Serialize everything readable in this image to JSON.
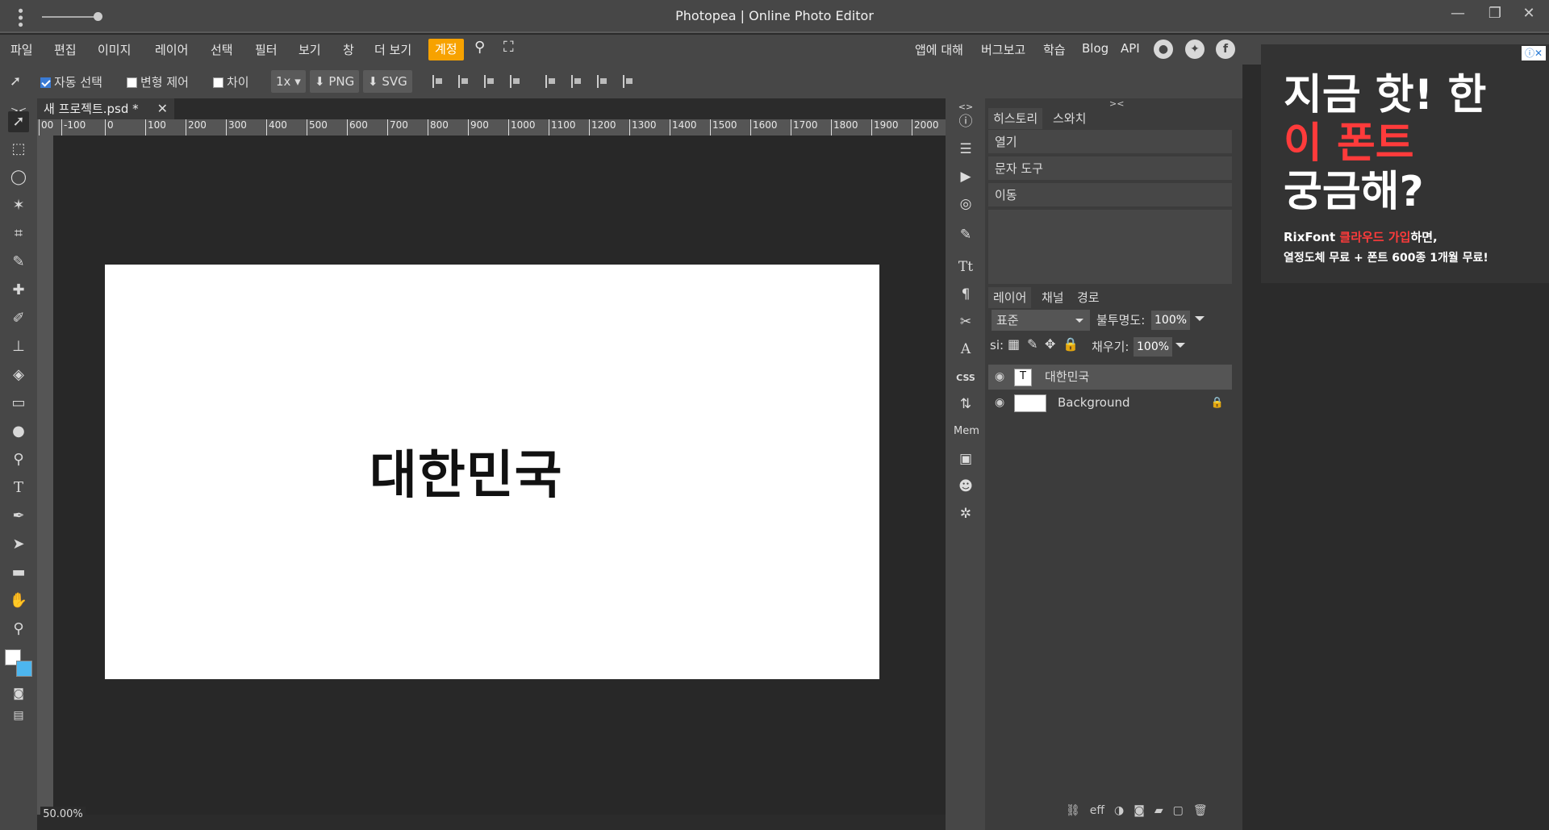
{
  "window": {
    "title": "Photopea | Online Photo Editor"
  },
  "menu": {
    "items": [
      "파일",
      "편집",
      "이미지",
      "레이어",
      "선택",
      "필터",
      "보기",
      "창",
      "더 보기"
    ],
    "account": "계정",
    "right_items": [
      "앱에 대해",
      "버그보고",
      "학습",
      "Blog",
      "API"
    ]
  },
  "options": {
    "auto_select": "자동 선택",
    "transform": "변형 제어",
    "diff": "차이",
    "scale": "1x",
    "png": "PNG",
    "svg": "SVG"
  },
  "document": {
    "tab_name": "새 프로젝트.psd *",
    "canvas_text": "대한민국",
    "zoom": "50.00%",
    "ruler_labels": [
      "00",
      "-100",
      "0",
      "100",
      "200",
      "300",
      "400",
      "500",
      "600",
      "700",
      "800",
      "900",
      "1000",
      "1100",
      "1200",
      "1300",
      "1400",
      "1500",
      "1600",
      "1700",
      "1800",
      "1900",
      "2000"
    ]
  },
  "panel": {
    "tabs": [
      "히스토리",
      "스와치"
    ],
    "history": [
      "열기",
      "문자 도구",
      "이동"
    ],
    "layer_tabs": [
      "레이어",
      "채널",
      "경로"
    ],
    "blend_mode": "표준",
    "opacity_label": "불투명도:",
    "opacity_value": "100%",
    "lock_label": "si:",
    "fill_label": "채우기:",
    "fill_value": "100%",
    "layers": [
      "대한민국",
      "Background"
    ],
    "bottom": [
      "⛓",
      "eff"
    ]
  },
  "mid": {
    "css": "CSS",
    "mem": "Mem"
  },
  "ad": {
    "line1": "지금 핫! 한",
    "line2": "이 폰트",
    "line3": "궁금해?",
    "brand": "RixFont",
    "cloud": "클라우드 가입",
    "suffix": "하면,",
    "line5": "열정도체 무료 + 폰트 600종 1개월 무료!"
  }
}
